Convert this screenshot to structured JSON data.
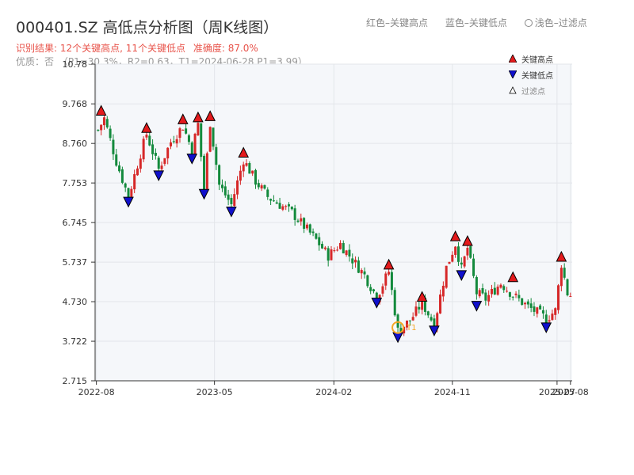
{
  "header": {
    "title": "000401.SZ 高低点分析图（周K线图）",
    "legend_high": "红色–关键高点",
    "legend_low": "蓝色–关键低点",
    "legend_filtered": "浅色–过滤点",
    "result_label": "识别结果: 12个关键高点, 11个关键低点",
    "accuracy": "准确度: 87.0%",
    "quality": "优质：否",
    "params": "（P1=30.3%，R2=0.63，T1=2024-06-28 P1=3.99）"
  },
  "legend": {
    "high": "关键高点",
    "low": "关键低点",
    "filtered": "过滤点"
  },
  "colors": {
    "up": "#d62728",
    "down": "#138a3c",
    "high_marker": "#e31a1c",
    "low_marker": "#1010cc",
    "highlight": "#f5a623",
    "plot_bg": "#f5f7fa",
    "grid": "#e3e6ea"
  },
  "chart_data": {
    "type": "candlestick",
    "x_axis": {
      "ticks": [
        "2022-08",
        "2023-05",
        "2024-02",
        "2024-11",
        "2025-07",
        "2025-08"
      ]
    },
    "y_axis": {
      "ticks": [
        "2.715",
        "3.722",
        "4.730",
        "5.737",
        "6.745",
        "7.753",
        "8.760",
        "9.768",
        "10.78"
      ],
      "ylim": [
        2.715,
        10.78
      ]
    },
    "price_path": [
      [
        "2022-08-05",
        9.1
      ],
      [
        "2022-08-19",
        9.4
      ],
      [
        "2022-09-16",
        8.3
      ],
      [
        "2022-10-14",
        7.4
      ],
      [
        "2022-11-11",
        8.5
      ],
      [
        "2022-11-25",
        9.0
      ],
      [
        "2022-12-23",
        8.1
      ],
      [
        "2023-01-20",
        8.8
      ],
      [
        "2023-02-17",
        9.2
      ],
      [
        "2023-03-10",
        8.6
      ],
      [
        "2023-03-24",
        9.25
      ],
      [
        "2023-04-07",
        7.6
      ],
      [
        "2023-04-21",
        9.3
      ],
      [
        "2023-05-12",
        7.7
      ],
      [
        "2023-06-09",
        7.2
      ],
      [
        "2023-07-07",
        8.35
      ],
      [
        "2023-08-04",
        7.8
      ],
      [
        "2023-09-01",
        7.4
      ],
      [
        "2023-10-27",
        7.0
      ],
      [
        "2023-12-22",
        6.3
      ],
      [
        "2024-01-19",
        5.9
      ],
      [
        "2024-02-16",
        6.2
      ],
      [
        "2024-04-12",
        5.4
      ],
      [
        "2024-05-10",
        4.85
      ],
      [
        "2024-06-07",
        5.5
      ],
      [
        "2024-06-28",
        3.99
      ],
      [
        "2024-07-26",
        4.25
      ],
      [
        "2024-08-23",
        4.7
      ],
      [
        "2024-09-20",
        4.15
      ],
      [
        "2024-10-18",
        5.6
      ],
      [
        "2024-11-08",
        6.2
      ],
      [
        "2024-11-22",
        5.55
      ],
      [
        "2024-12-06",
        6.1
      ],
      [
        "2024-12-27",
        4.95
      ],
      [
        "2025-01-17",
        4.8
      ],
      [
        "2025-02-21",
        5.2
      ],
      [
        "2025-03-21",
        4.9
      ],
      [
        "2025-04-25",
        4.6
      ],
      [
        "2025-06-06",
        4.3
      ],
      [
        "2025-06-27",
        4.5
      ],
      [
        "2025-07-11",
        5.7
      ],
      [
        "2025-07-25",
        4.95
      ],
      [
        "2025-08-01",
        4.9
      ]
    ],
    "key_highs": [
      {
        "date": "2022-08-12",
        "value": 9.42
      },
      {
        "date": "2022-11-25",
        "value": 8.98
      },
      {
        "date": "2023-02-17",
        "value": 9.2
      },
      {
        "date": "2023-03-24",
        "value": 9.25
      },
      {
        "date": "2023-04-21",
        "value": 9.28
      },
      {
        "date": "2023-07-07",
        "value": 8.35
      },
      {
        "date": "2024-06-07",
        "value": 5.5
      },
      {
        "date": "2024-08-23",
        "value": 4.68
      },
      {
        "date": "2024-11-08",
        "value": 6.22
      },
      {
        "date": "2024-12-06",
        "value": 6.1
      },
      {
        "date": "2025-03-21",
        "value": 5.18
      },
      {
        "date": "2025-07-11",
        "value": 5.7
      }
    ],
    "key_lows": [
      {
        "date": "2022-10-14",
        "value": 7.45
      },
      {
        "date": "2022-12-23",
        "value": 8.12
      },
      {
        "date": "2023-03-10",
        "value": 8.55
      },
      {
        "date": "2023-04-07",
        "value": 7.65
      },
      {
        "date": "2023-06-09",
        "value": 7.2
      },
      {
        "date": "2024-05-10",
        "value": 4.88
      },
      {
        "date": "2024-06-28",
        "value": 4.0
      },
      {
        "date": "2024-09-20",
        "value": 4.17
      },
      {
        "date": "2024-11-22",
        "value": 5.58
      },
      {
        "date": "2024-12-27",
        "value": 4.8
      },
      {
        "date": "2025-06-06",
        "value": 4.25
      }
    ],
    "highlight": {
      "date": "2024-06-28",
      "value": 3.99,
      "label": "T1"
    }
  }
}
